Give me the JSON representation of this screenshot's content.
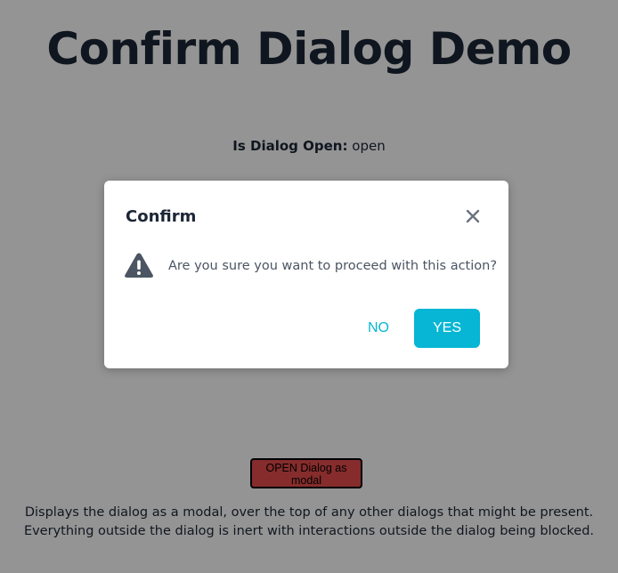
{
  "page": {
    "title": "Confirm Dialog Demo",
    "status_label": "Is Dialog Open:",
    "status_value": "open",
    "open_button_label": "OPEN Dialog as modal",
    "description_line1": "Displays the dialog as a modal, over the top of any other dialogs that might be present.",
    "description_line2": "Everything outside the dialog is inert with interactions outside the dialog being blocked."
  },
  "dialog": {
    "title": "Confirm",
    "message": "Are you sure you want to proceed with this action?",
    "no_label": "NO",
    "yes_label": "YES",
    "close_icon": "close-icon",
    "warning_icon": "warning-icon"
  },
  "colors": {
    "accent": "#06b6d4",
    "open_button_bg": "#e74c4c",
    "heading": "#1c2636",
    "overlay": "rgba(0,0,0,0.42)"
  }
}
